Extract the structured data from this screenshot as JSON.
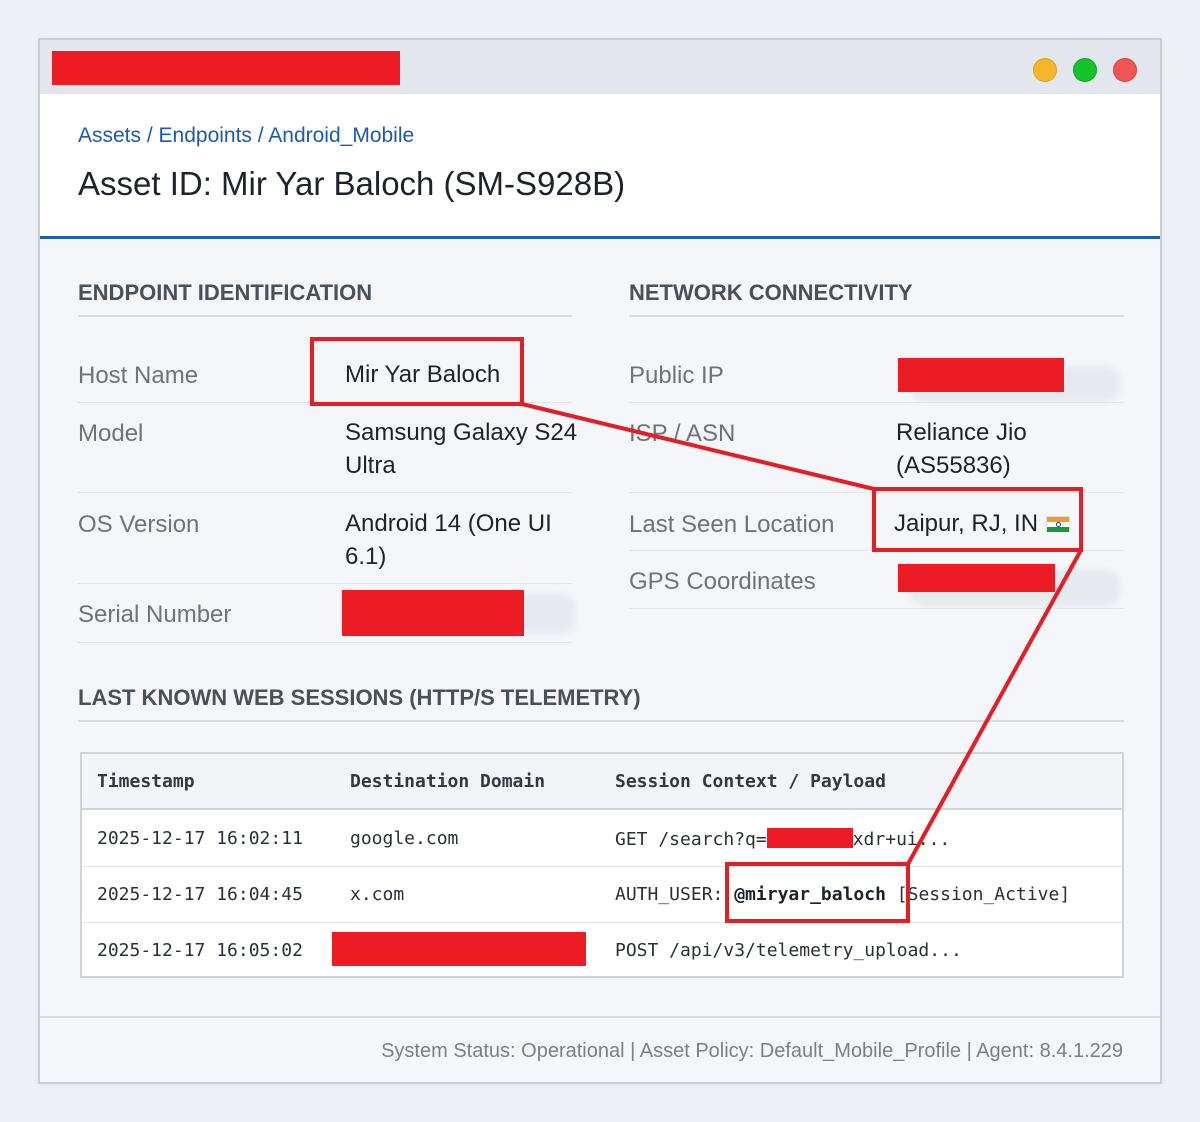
{
  "window": {
    "controls": [
      "minimize-dot",
      "maximize-dot",
      "close-dot"
    ],
    "colors": {
      "minimize": "#f6b62a",
      "maximize": "#14c22a",
      "close": "#f05555",
      "redaction": "#ed1c24",
      "accent": "#1d5fb4"
    }
  },
  "header": {
    "breadcrumb": "Assets / Endpoints / Android_Mobile",
    "title": "Asset ID: Mir Yar Baloch (SM-S928B)"
  },
  "endpoint": {
    "section_title": "ENDPOINT IDENTIFICATION",
    "host_label": "Host Name",
    "host_value": "Mir Yar Baloch",
    "model_label": "Model",
    "model_value": "Samsung Galaxy S24 Ultra",
    "os_label": "OS Version",
    "os_value": "Android 14 (One UI 6.1)",
    "serial_label": "Serial Number"
  },
  "network": {
    "section_title": "NETWORK CONNECTIVITY",
    "ip_label": "Public IP",
    "isp_label": "ISP / ASN",
    "isp_value": "Reliance Jio (AS55836)",
    "location_label": "Last Seen Location",
    "location_value": "Jaipur, RJ, IN",
    "location_flag": "india-flag-icon",
    "gps_label": "GPS Coordinates"
  },
  "sessions": {
    "section_title": "LAST KNOWN WEB SESSIONS (HTTP/S TELEMETRY)",
    "columns": [
      "Timestamp",
      "Destination Domain",
      "Session Context / Payload"
    ],
    "rows": [
      {
        "timestamp": "2025-12-17 16:02:11",
        "domain": "google.com",
        "payload_prefix": "GET /search?q=",
        "payload_suffix": "xdr+ui..."
      },
      {
        "timestamp": "2025-12-17 16:04:45",
        "domain": "x.com",
        "payload_prefix": "AUTH_USER: ",
        "payload_user": "@miryar_baloch",
        "payload_suffix": " [Session_Active]"
      },
      {
        "timestamp": "2025-12-17 16:05:02",
        "payload": "POST /api/v3/telemetry_upload..."
      }
    ]
  },
  "footer": {
    "status": "System Status: Operational | Asset Policy: Default_Mobile_Profile | Agent: 8.4.1.229"
  }
}
